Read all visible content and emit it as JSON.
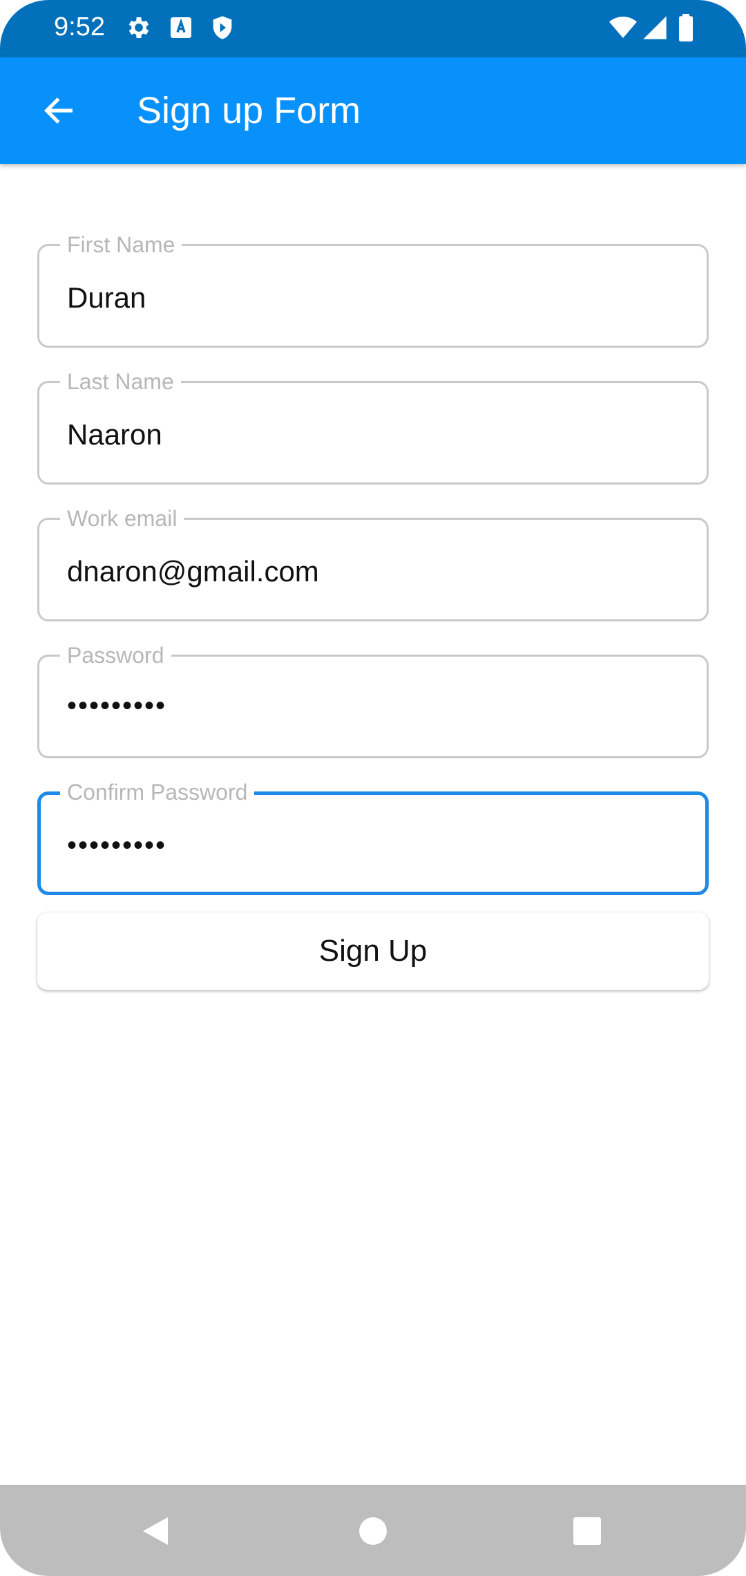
{
  "status_bar": {
    "time": "9:52",
    "left_icons": [
      "settings-icon",
      "keyboard-a-icon",
      "shield-play-icon"
    ],
    "right_icons": [
      "wifi-icon",
      "signal-icon",
      "battery-icon"
    ]
  },
  "app_bar": {
    "title": "Sign up Form",
    "back_icon": "arrow-back-icon",
    "color": "#0891fa"
  },
  "form": {
    "fields": [
      {
        "label": "First Name",
        "value": "Duran",
        "type": "text",
        "focused": false
      },
      {
        "label": "Last Name",
        "value": "Naaron",
        "type": "text",
        "focused": false
      },
      {
        "label": "Work email",
        "value": "dnaron@gmail.com",
        "type": "email",
        "focused": false
      },
      {
        "label": "Password",
        "value": "•••••••••",
        "type": "password",
        "focused": false
      },
      {
        "label": "Confirm Password",
        "value": "•••••••••",
        "type": "password",
        "focused": true
      }
    ],
    "submit_label": "Sign Up",
    "focus_color": "#1c8ae6"
  },
  "nav_bar": {
    "buttons": [
      "back-triangle-icon",
      "home-circle-icon",
      "recents-square-icon"
    ]
  }
}
